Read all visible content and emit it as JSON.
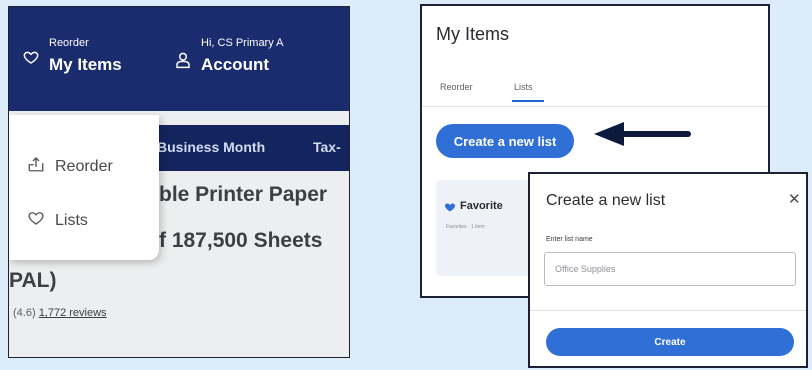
{
  "header": {
    "reorder_small": "Reorder",
    "my_items": "My Items",
    "greeting": "Hi, CS Primary A",
    "account": "Account"
  },
  "subnav": {
    "items": [
      "Business Month",
      "Tax-"
    ]
  },
  "dropdown": {
    "items": [
      {
        "label": "Reorder",
        "icon": "reorder-icon"
      },
      {
        "label": "Lists",
        "icon": "heart-icon"
      }
    ]
  },
  "product": {
    "title_line1": "ble Printer Paper",
    "title_line2": "f 187,500 Sheets",
    "title_line3": "PAL)",
    "rating": "(4.6)",
    "reviews": "1,772 reviews"
  },
  "my_items_panel": {
    "title": "My Items",
    "tabs": [
      "Reorder",
      "Lists"
    ],
    "active_tab": "Lists",
    "create_button": "Create a new list",
    "favorites_label": "Favorite",
    "favorites_sub": "Favorites · 1 item"
  },
  "modal": {
    "title": "Create a new list",
    "close": "✕",
    "field_label": "Enter list name",
    "input_placeholder": "Office Supplies",
    "create_button": "Create"
  },
  "colors": {
    "nav_blue": "#1a2c6e",
    "accent_blue": "#2f6fd6",
    "arrow": "#0e1a3c"
  }
}
